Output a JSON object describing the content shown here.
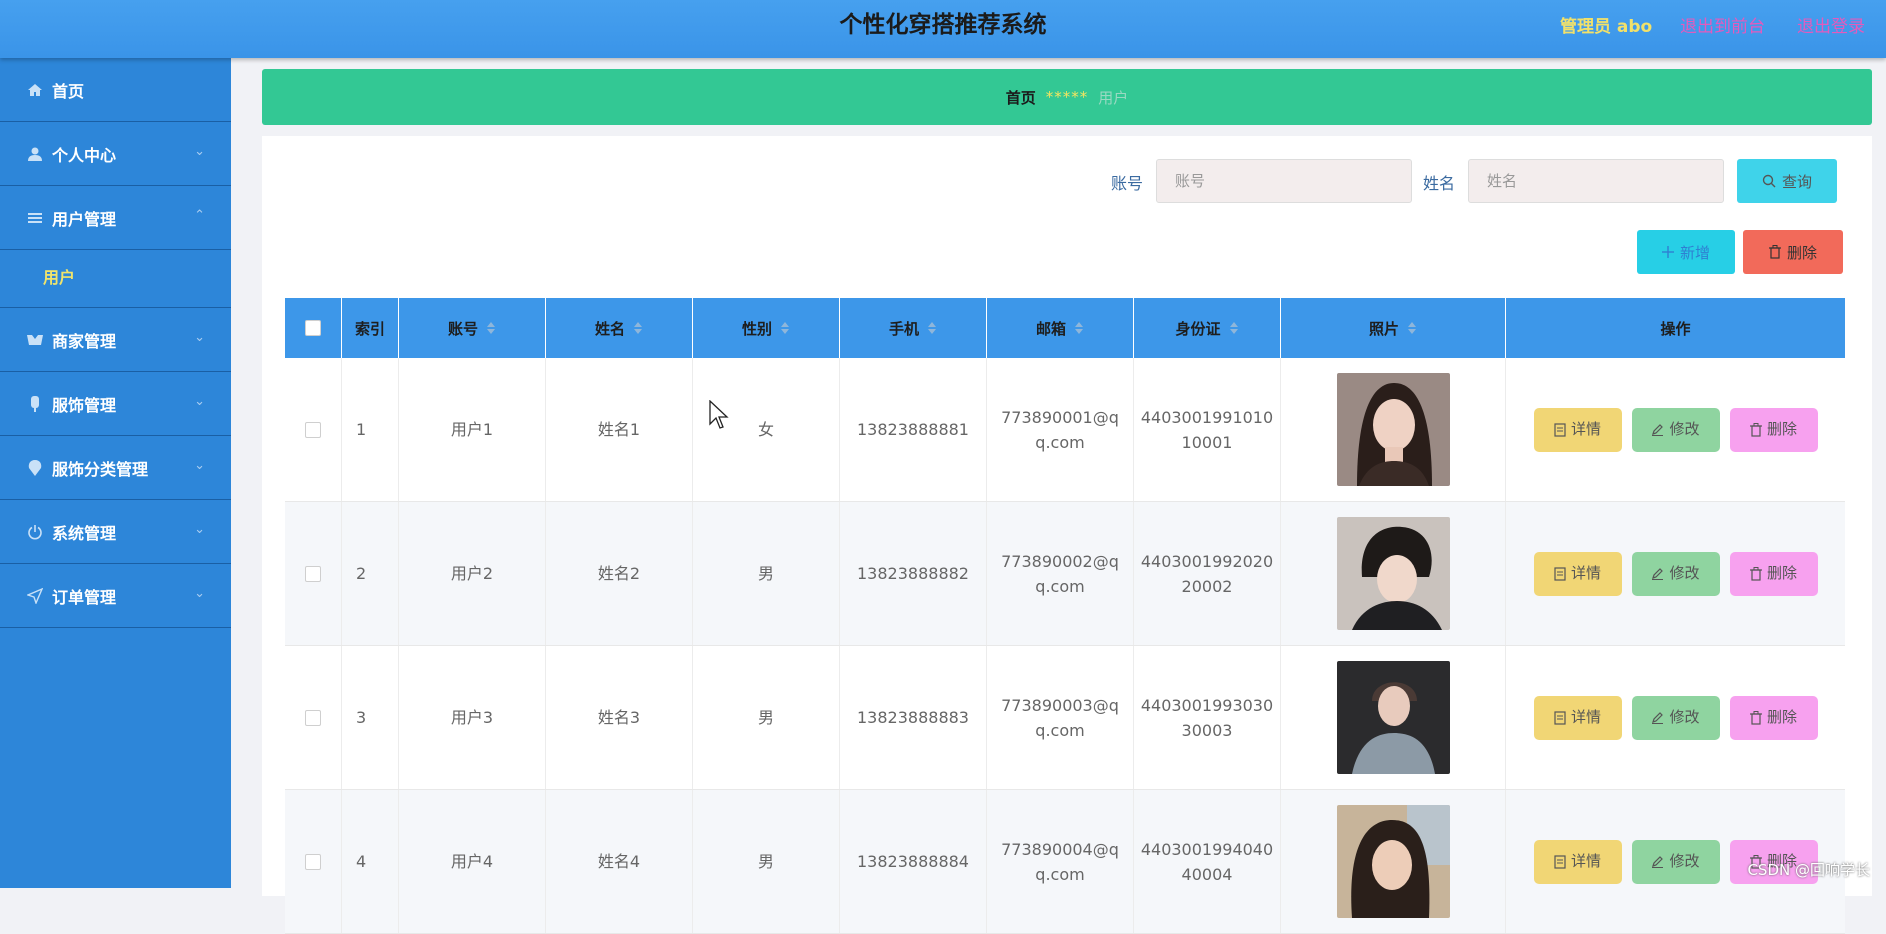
{
  "app": {
    "title": "个性化穿搭推荐系统",
    "admin": "管理员 abo",
    "to_frontend": "退出到前台",
    "logout": "退出登录"
  },
  "sidebar": {
    "items": [
      {
        "label": "首页",
        "icon": "home-icon"
      },
      {
        "label": "个人中心",
        "icon": "user-icon"
      },
      {
        "label": "用户管理",
        "icon": "list-icon",
        "expanded": true
      },
      {
        "label": "商家管理",
        "icon": "store-icon"
      },
      {
        "label": "服饰管理",
        "icon": "clothing-icon"
      },
      {
        "label": "服饰分类管理",
        "icon": "category-icon"
      },
      {
        "label": "系统管理",
        "icon": "power-icon"
      },
      {
        "label": "订单管理",
        "icon": "send-icon"
      }
    ],
    "submenu_active": "用户"
  },
  "breadcrumb": {
    "home": "首页",
    "separator": "*****",
    "current": "用户"
  },
  "search": {
    "account_label": "账号",
    "account_placeholder": "账号",
    "name_label": "姓名",
    "name_placeholder": "姓名",
    "query_button": "查询"
  },
  "toolbar": {
    "add_label": "新增",
    "delete_label": "删除"
  },
  "table": {
    "headers": [
      "索引",
      "账号",
      "姓名",
      "性别",
      "手机",
      "邮箱",
      "身份证",
      "照片",
      "操作"
    ],
    "rows": [
      {
        "index": "1",
        "account": "用户1",
        "name": "姓名1",
        "gender": "女",
        "phone": "13823888881",
        "email_1": "773890001@q",
        "email_2": "q.com",
        "id_1": "4403001991010",
        "id_2": "10001"
      },
      {
        "index": "2",
        "account": "用户2",
        "name": "姓名2",
        "gender": "男",
        "phone": "13823888882",
        "email_1": "773890002@q",
        "email_2": "q.com",
        "id_1": "4403001992020",
        "id_2": "20002"
      },
      {
        "index": "3",
        "account": "用户3",
        "name": "姓名3",
        "gender": "男",
        "phone": "13823888883",
        "email_1": "773890003@q",
        "email_2": "q.com",
        "id_1": "4403001993030",
        "id_2": "30003"
      },
      {
        "index": "4",
        "account": "用户4",
        "name": "姓名4",
        "gender": "男",
        "phone": "13823888884",
        "email_1": "773890004@q",
        "email_2": "q.com",
        "id_1": "4403001994040",
        "id_2": "40004"
      }
    ],
    "actions": {
      "detail": "详情",
      "edit": "修改",
      "delete": "删除"
    }
  },
  "watermark": "CSDN @回响学长",
  "colors": {
    "header": "#3a94e8",
    "sidebar": "#2d86d9",
    "breadcrumb": "#33c894",
    "table_header": "#3d97e9",
    "detail_btn": "#f1d675",
    "edit_btn": "#8fd4a0",
    "delete_btn": "#f7a1ef",
    "add_btn": "#27cfe6",
    "bulk_delete_btn": "#f26a5a"
  }
}
